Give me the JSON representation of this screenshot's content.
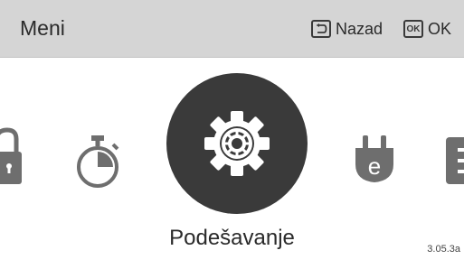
{
  "header": {
    "title": "Meni",
    "back_label": "Nazad",
    "ok_key": "OK",
    "ok_label": "OK"
  },
  "carousel": {
    "items": [
      {
        "icon": "lock-icon"
      },
      {
        "icon": "timer-icon"
      },
      {
        "icon": "gear-icon",
        "selected": true,
        "label": "Podešavanje"
      },
      {
        "icon": "energy-plug-icon",
        "glyph": "e"
      },
      {
        "icon": "partial-icon"
      }
    ]
  },
  "footer": {
    "code": "3.05.3a"
  },
  "colors": {
    "header_bg": "#d5d5d5",
    "icon": "#6e6e6e",
    "selected_bg": "#3a3a3a",
    "selected_icon": "#ffffff"
  }
}
